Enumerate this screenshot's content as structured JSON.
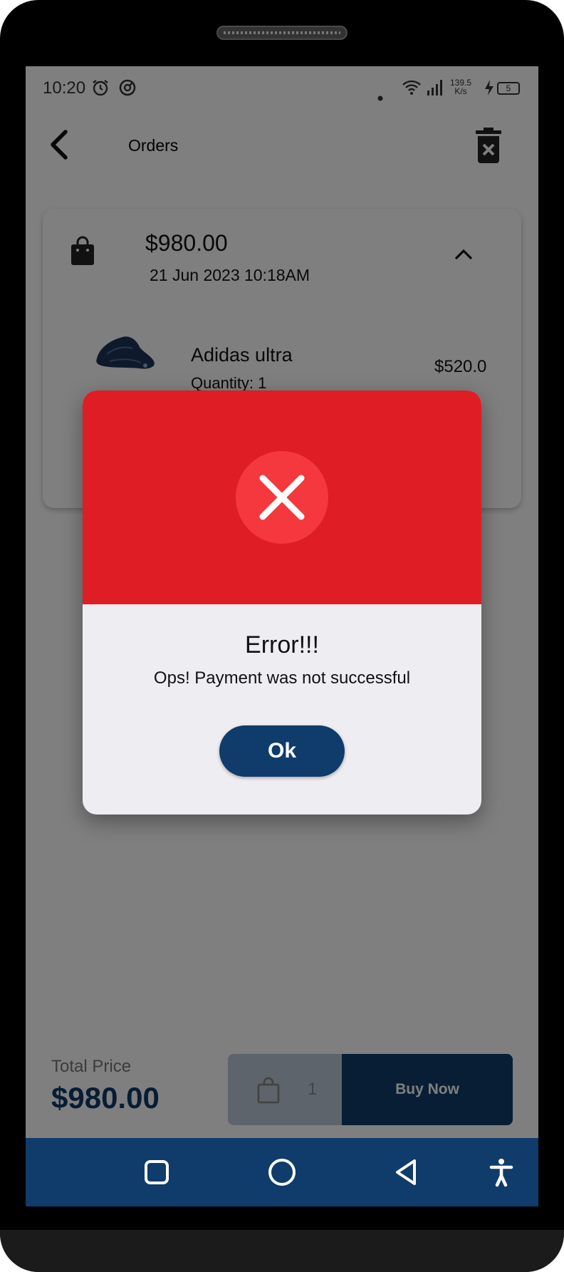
{
  "status_bar": {
    "time": "10:20",
    "net_speed": "139.5",
    "net_unit": "K/s",
    "battery": "5"
  },
  "appbar": {
    "title": "Orders"
  },
  "order": {
    "total": "$980.00",
    "date": "21 Jun 2023 10:18AM",
    "item": {
      "name": "Adidas ultra",
      "quantity": "Quantity: 1",
      "price": "$520.0"
    }
  },
  "footer": {
    "total_label": "Total Price",
    "total_value": "$980.00",
    "cart_count": "1",
    "buy_label": "Buy Now"
  },
  "dialog": {
    "title": "Error!!!",
    "message": "Ops! Payment was not successful",
    "ok_label": "Ok"
  },
  "colors": {
    "primary": "#0f3c6a",
    "error_red": "#de1d25",
    "error_circle": "#f4383e"
  }
}
